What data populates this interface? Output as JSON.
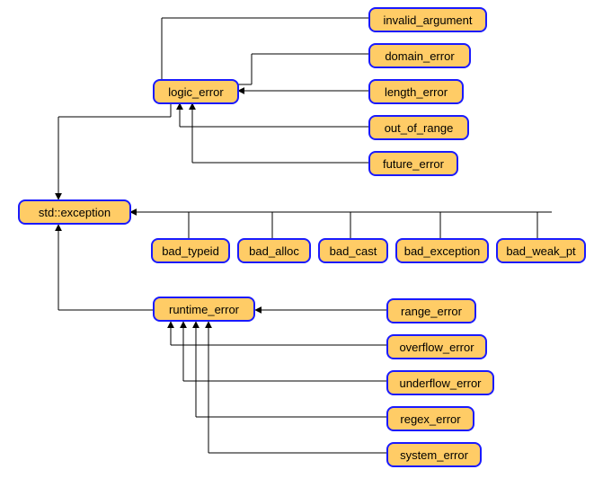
{
  "nodes": {
    "std_exception": "std::exception",
    "logic_error": "logic_error",
    "runtime_error": "runtime_error",
    "invalid_argument": "invalid_argument",
    "domain_error": "domain_error",
    "length_error": "length_error",
    "out_of_range": "out_of_range",
    "future_error": "future_error",
    "range_error": "range_error",
    "overflow_error": "overflow_error",
    "underflow_error": "underflow_error",
    "regex_error": "regex_error",
    "system_error": "system_error",
    "bad_typeid": "bad_typeid",
    "bad_alloc": "bad_alloc",
    "bad_cast": "bad_cast",
    "bad_exception": "bad_exception",
    "bad_weak_pt": "bad_weak_pt"
  },
  "edges": [
    [
      "logic_error",
      "std_exception"
    ],
    [
      "runtime_error",
      "std_exception"
    ],
    [
      "bad_typeid",
      "std_exception"
    ],
    [
      "bad_alloc",
      "std_exception"
    ],
    [
      "bad_cast",
      "std_exception"
    ],
    [
      "bad_exception",
      "std_exception"
    ],
    [
      "bad_weak_pt",
      "std_exception"
    ],
    [
      "invalid_argument",
      "logic_error"
    ],
    [
      "domain_error",
      "logic_error"
    ],
    [
      "length_error",
      "logic_error"
    ],
    [
      "out_of_range",
      "logic_error"
    ],
    [
      "future_error",
      "logic_error"
    ],
    [
      "range_error",
      "runtime_error"
    ],
    [
      "overflow_error",
      "runtime_error"
    ],
    [
      "underflow_error",
      "runtime_error"
    ],
    [
      "regex_error",
      "runtime_error"
    ],
    [
      "system_error",
      "runtime_error"
    ]
  ],
  "colors": {
    "node_fill": "#ffcc66",
    "node_border": "#1a1aff"
  }
}
